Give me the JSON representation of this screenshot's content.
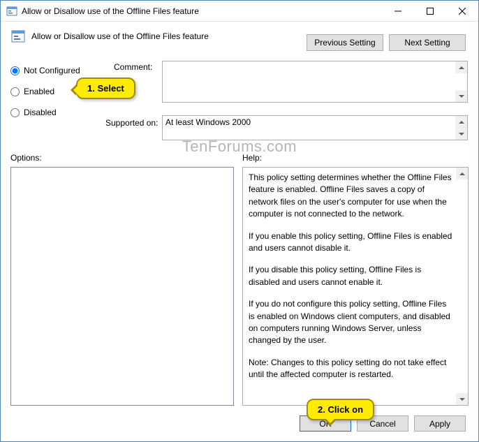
{
  "window": {
    "title": "Allow or Disallow use of the Offline Files feature",
    "subtitle": "Allow or Disallow use of the Offline Files feature"
  },
  "nav": {
    "previous": "Previous Setting",
    "next": "Next Setting"
  },
  "radios": {
    "not_configured": "Not Configured",
    "enabled": "Enabled",
    "disabled": "Disabled",
    "selected": "not_configured"
  },
  "labels": {
    "comment": "Comment:",
    "supported": "Supported on:",
    "options": "Options:",
    "help": "Help:"
  },
  "supported_text": "At least Windows 2000",
  "help_text": {
    "p1": "This policy setting determines whether the Offline Files feature is enabled. Offline Files saves a copy of network files on the user's computer for use when the computer is not connected to the network.",
    "p2": "If you enable this policy setting, Offline Files is enabled and users cannot disable it.",
    "p3": "If you disable this policy setting, Offline Files is disabled and users cannot enable it.",
    "p4": "If you do not configure this policy setting, Offline Files is enabled on Windows client computers, and disabled on computers running Windows Server, unless changed by the user.",
    "p5": "Note: Changes to this policy setting do not take effect until the affected computer is restarted."
  },
  "buttons": {
    "ok": "OK",
    "cancel": "Cancel",
    "apply": "Apply"
  },
  "callouts": {
    "c1": "1. Select",
    "c2": "2. Click on"
  },
  "watermark": "TenForums.com"
}
